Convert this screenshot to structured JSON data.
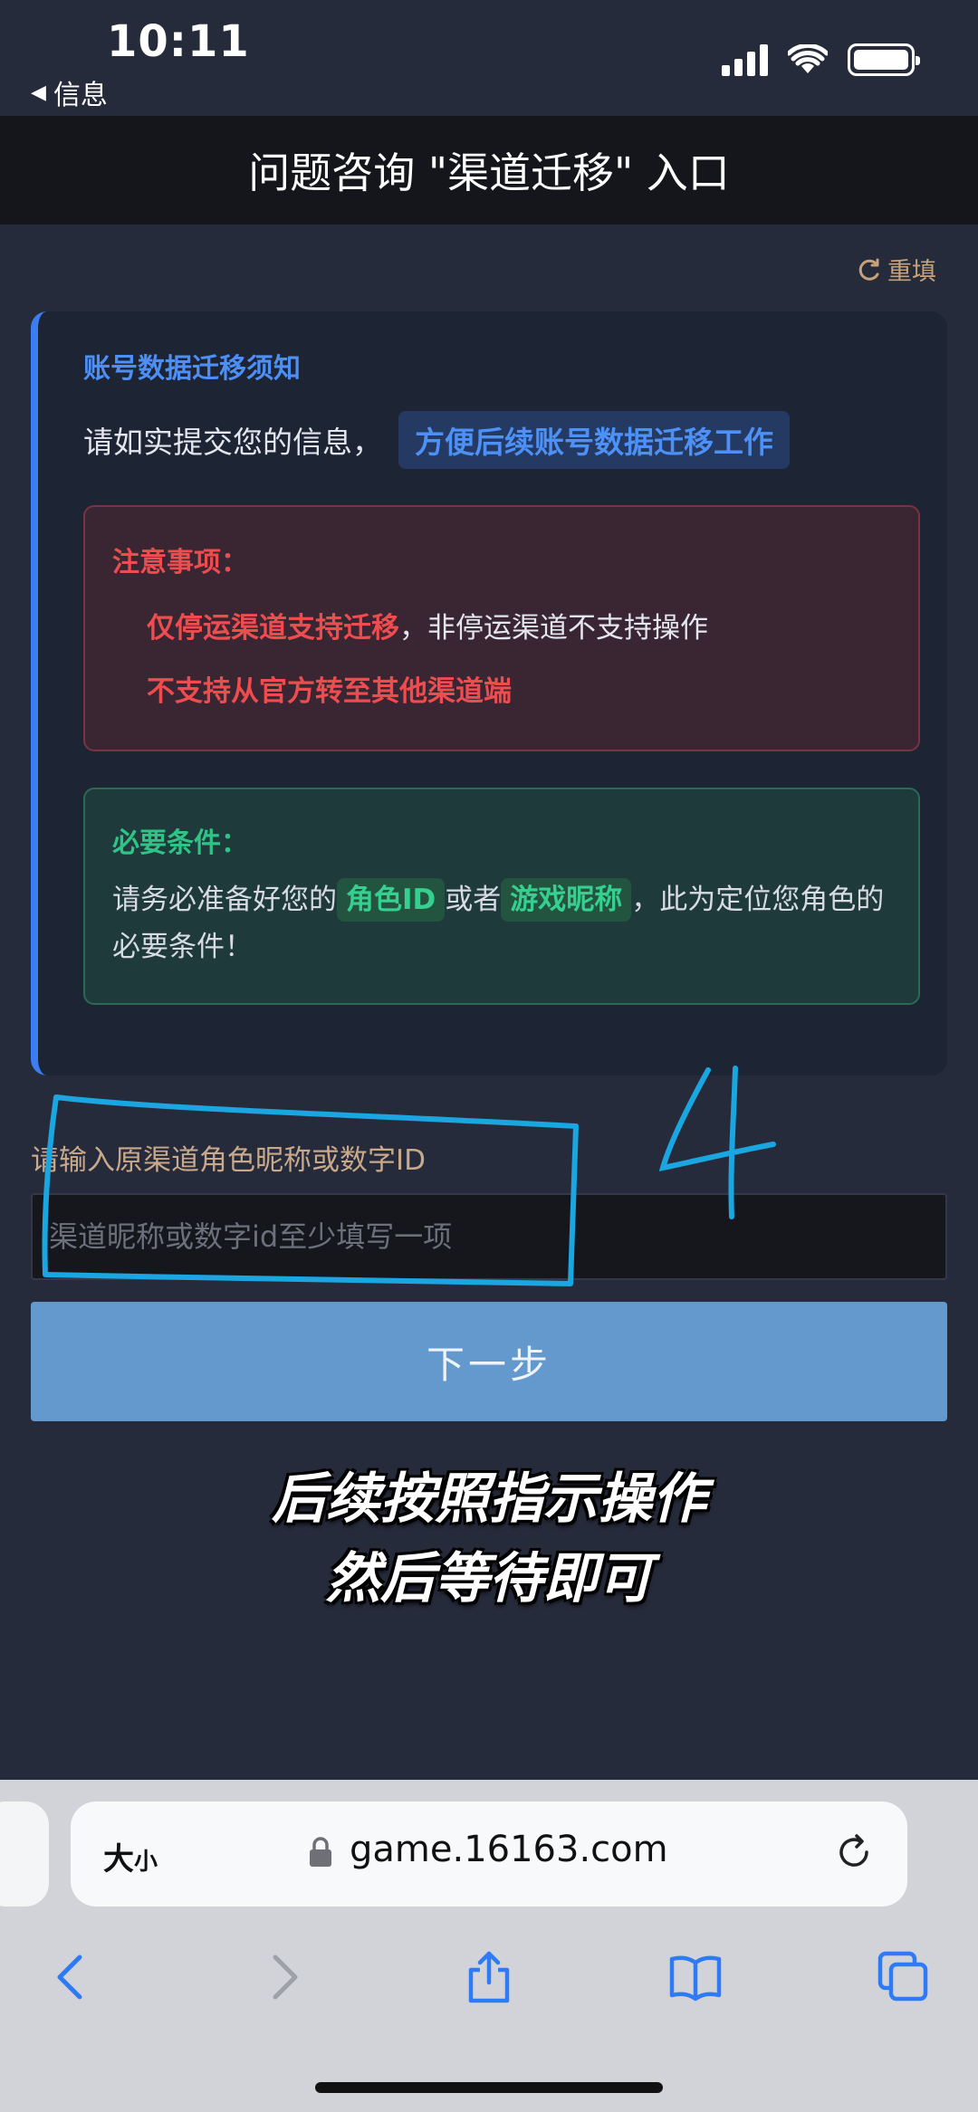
{
  "status_bar": {
    "time": "10:11",
    "back_app": "信息",
    "back_icon": "triangle-left-icon"
  },
  "header": {
    "title": "问题咨询 \"渠道迁移\" 入口"
  },
  "reset_label": "重填",
  "notice": {
    "heading": "账号数据迁移须知",
    "line_prefix": "请如实提交您的信息，",
    "line_tag": "方便后续账号数据迁移工作",
    "warning": {
      "title": "注意事项：",
      "item1_red": "仅停运渠道支持迁移",
      "item1_rest": "，非停运渠道不支持操作",
      "item2": "不支持从官方转至其他渠道端"
    },
    "requirement": {
      "title": "必要条件：",
      "text_prefix": "请务必准备好您的",
      "tag1": "角色ID",
      "text_mid": "或者",
      "tag2": "游戏昵称",
      "text_suffix": "，此为定位您角色的必要条件！"
    }
  },
  "form": {
    "label": "请输入原渠道角色昵称或数字ID",
    "placeholder": "渠道昵称或数字id至少填写一项",
    "value": "",
    "next_button": "下一步"
  },
  "caption": {
    "line1": "后续按照指示操作",
    "line2": "然后等待即可"
  },
  "browser": {
    "text_size": "大",
    "text_size_small": "小",
    "url": "game.16163.com"
  },
  "colors": {
    "page_bg": "#262b3b",
    "accent_blue": "#3d7df2",
    "warn_red": "#ef4c4f",
    "ok_green": "#2fc486",
    "button_blue": "#6399cc",
    "annotation_cyan": "#1aa6e0"
  }
}
